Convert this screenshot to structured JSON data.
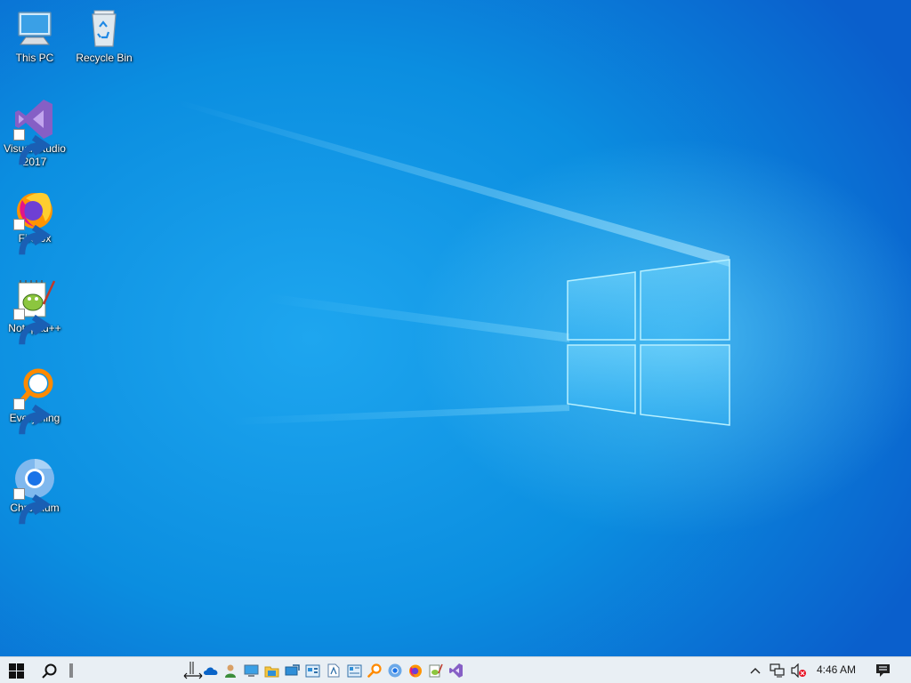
{
  "desktop": {
    "icons": [
      {
        "label": "This PC",
        "icon": "this-pc-icon",
        "shortcut": false
      },
      {
        "label": "Recycle Bin",
        "icon": "recycle-bin-icon",
        "shortcut": false
      },
      {
        "label": "Visual Studio 2017",
        "icon": "visual-studio-icon",
        "shortcut": true
      },
      {
        "label": "Firefox",
        "icon": "firefox-icon",
        "shortcut": true
      },
      {
        "label": "Notepad++",
        "icon": "notepad-plus-plus-icon",
        "shortcut": true
      },
      {
        "label": "Everything",
        "icon": "everything-search-icon",
        "shortcut": true
      },
      {
        "label": "Chromium",
        "icon": "chromium-icon",
        "shortcut": true
      }
    ]
  },
  "taskbar": {
    "start": "windows-start-icon",
    "search": "search-icon",
    "quick_launch": [
      "onedrive-icon",
      "user-icon",
      "monitor-icon",
      "file-explorer-icon",
      "remote-desktop-icon",
      "control-panel-icon",
      "document-icon",
      "system-info-icon",
      "everything-search-icon",
      "chromium-icon",
      "firefox-icon",
      "notepad-plus-plus-icon",
      "visual-studio-icon"
    ],
    "tray": {
      "clock": "4:46 AM",
      "icons": [
        "chevron-up-icon",
        "network-icon",
        "volume-muted-icon",
        "notification-center-icon"
      ]
    }
  },
  "colors": {
    "desktop_blue": "#0b8ee0",
    "taskbar_bg": "#e9eff4",
    "accent_blue": "#0078d7"
  }
}
